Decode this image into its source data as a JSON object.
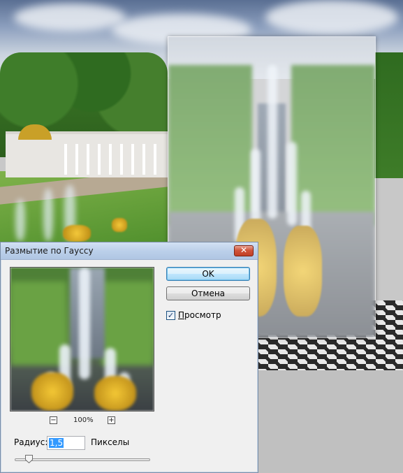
{
  "dialog": {
    "title": "Размытие по Гауссу",
    "close_symbol": "✕",
    "ok_label": "OK",
    "cancel_label": "Отмена",
    "preview_checkbox": {
      "label": "Просмотр",
      "checked": true,
      "check_glyph": "✓"
    },
    "zoom": {
      "minus": "−",
      "plus": "+",
      "level": "100%"
    },
    "radius": {
      "label": "Радиус:",
      "value": "1,5",
      "units": "Пикселы"
    },
    "slider_position": 0.08
  },
  "icons": {
    "close": "close-icon",
    "zoom_out": "zoom-out-icon",
    "zoom_in": "zoom-in-icon",
    "check": "check-icon"
  },
  "colors": {
    "ok_border": "#3c7fb1",
    "close_red": "#c23f24",
    "selection": "#3399ff"
  }
}
